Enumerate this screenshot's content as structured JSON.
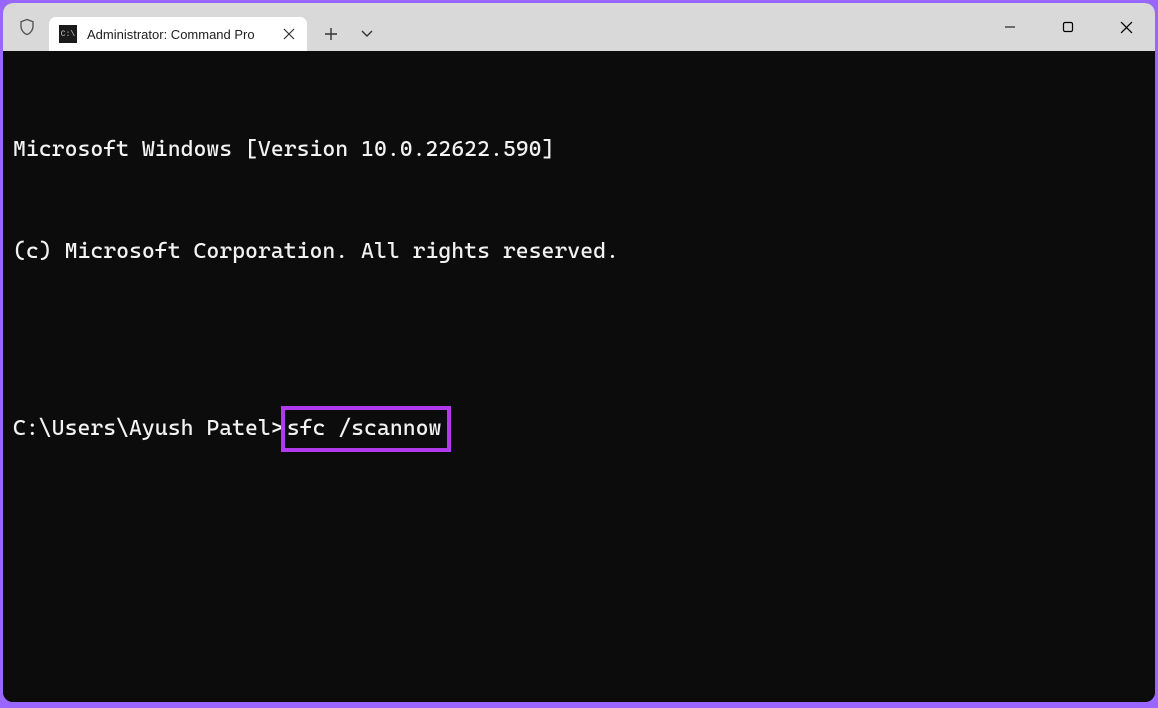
{
  "titlebar": {
    "tab_title": "Administrator: Command Pro",
    "shield_icon": "shield-icon",
    "terminal_icon": "terminal-icon"
  },
  "terminal": {
    "line1": "Microsoft Windows [Version 10.0.22622.590]",
    "line2": "(c) Microsoft Corporation. All rights reserved.",
    "blank": "",
    "prompt": "C:\\Users\\Ayush Patel>",
    "command": "sfc /scannow"
  }
}
